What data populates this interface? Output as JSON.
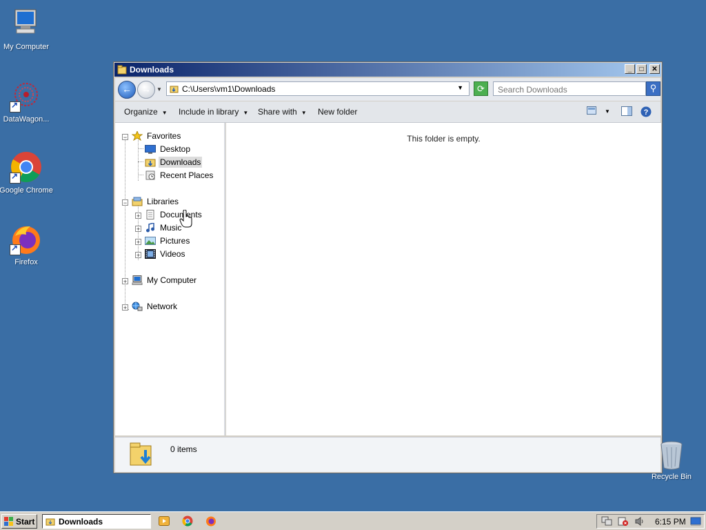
{
  "desktop": {
    "icons": [
      {
        "label": "My Computer",
        "icon": "computer-icon"
      },
      {
        "label": "DataWagon...",
        "icon": "datawagon-icon"
      },
      {
        "label": "Google Chrome",
        "icon": "chrome-icon"
      },
      {
        "label": "Firefox",
        "icon": "firefox-icon"
      }
    ],
    "recycle_bin": "Recycle Bin",
    "background_color": "#3a6ea5"
  },
  "window": {
    "title": "Downloads",
    "address": "C:\\Users\\vm1\\Downloads",
    "search_placeholder": "Search Downloads",
    "toolbar": {
      "organize": "Organize",
      "include_in_library": "Include in library",
      "share_with": "Share with",
      "new_folder": "New folder"
    },
    "nav": {
      "favorites": "Favorites",
      "desktop": "Desktop",
      "downloads": "Downloads",
      "recent_places": "Recent Places",
      "libraries": "Libraries",
      "documents": "Documents",
      "music": "Music",
      "pictures": "Pictures",
      "videos": "Videos",
      "my_computer": "My Computer",
      "network": "Network"
    },
    "empty_message": "This folder is empty.",
    "details_count": "0 items"
  },
  "taskbar": {
    "start": "Start",
    "task": "Downloads",
    "clock": "6:15 PM"
  }
}
